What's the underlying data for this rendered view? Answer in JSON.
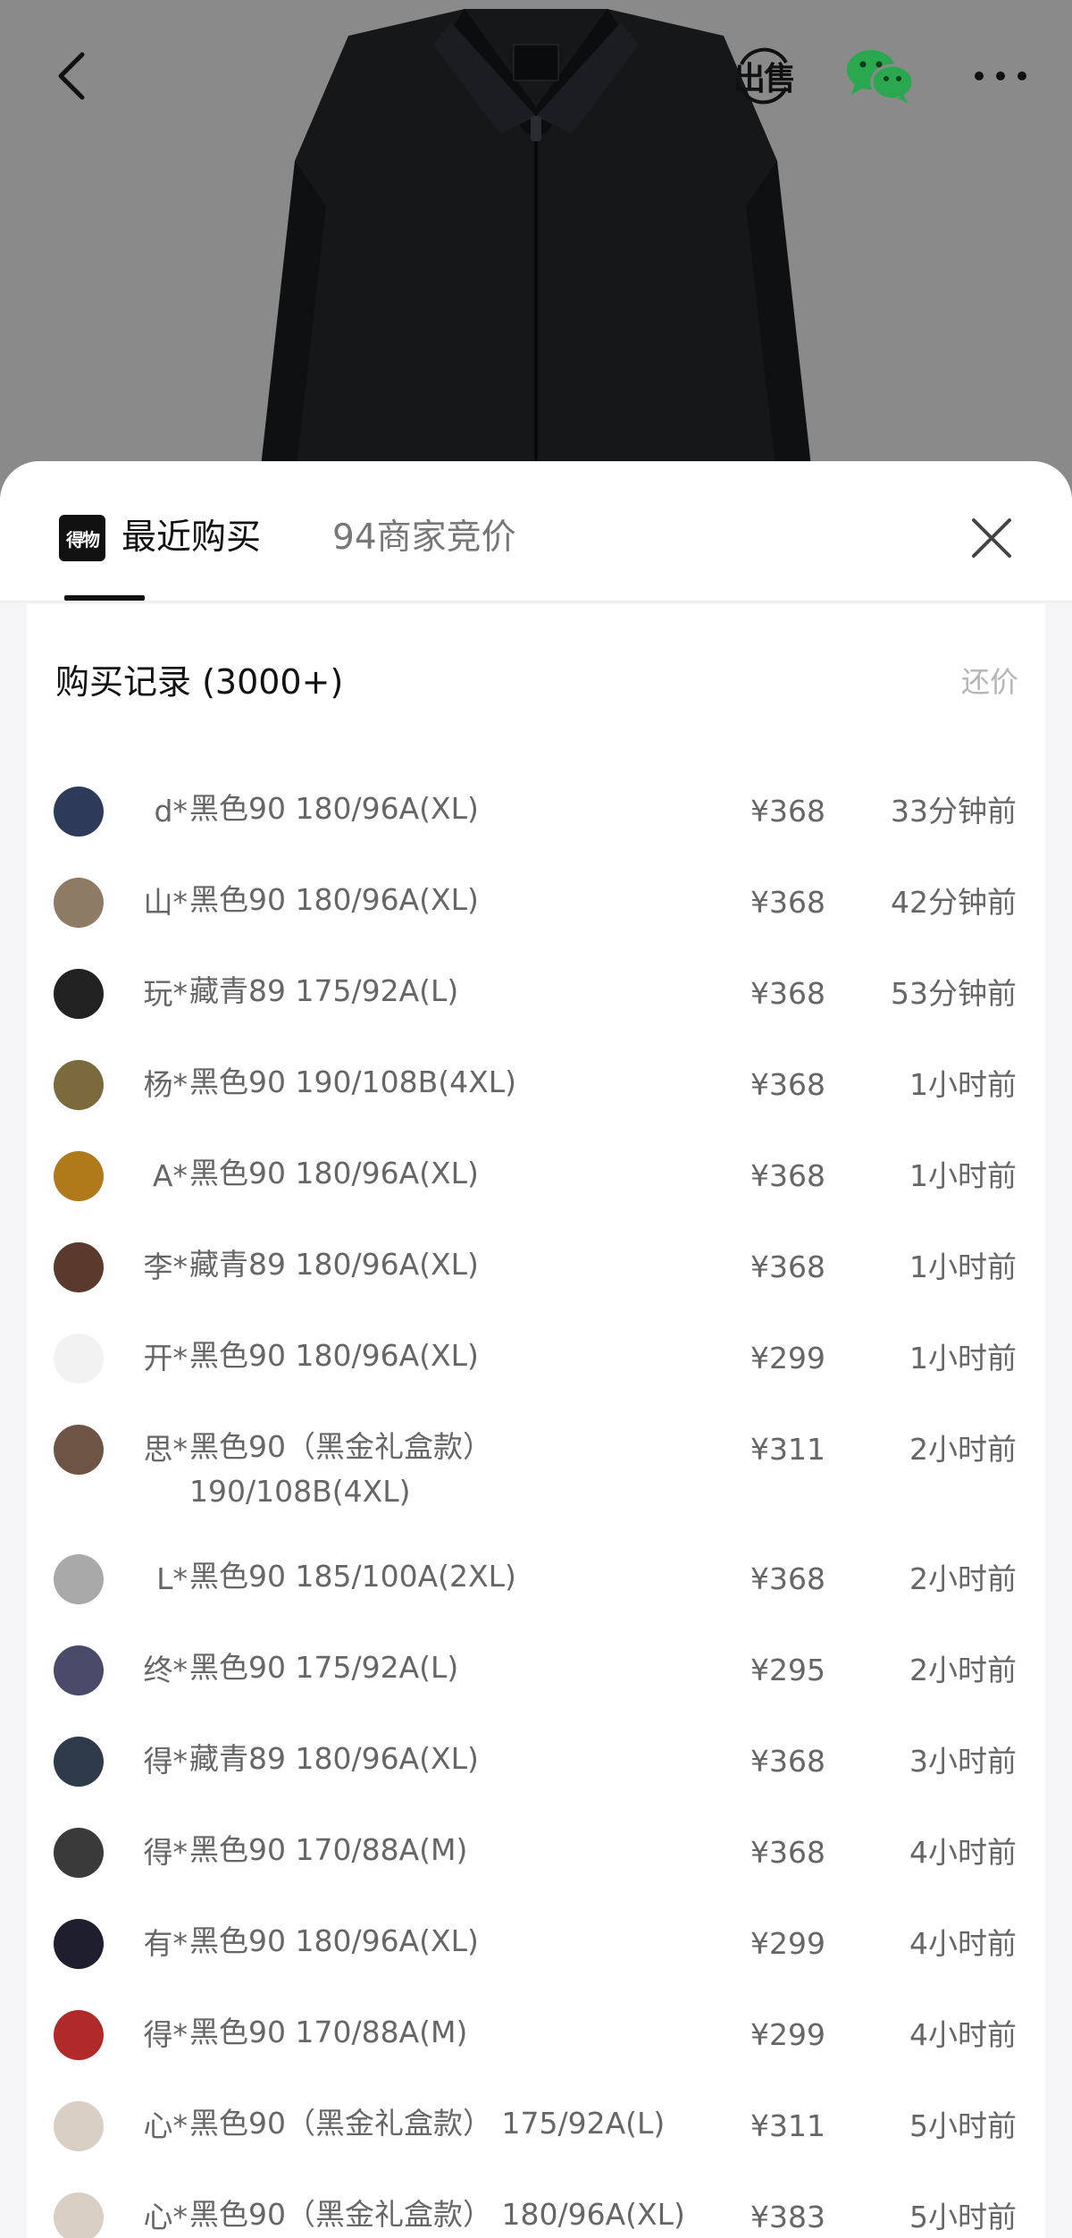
{
  "header": {
    "sell_label": "出售",
    "tabs": [
      {
        "logo": "得物",
        "label": "最近购买",
        "active": true
      },
      {
        "label": "94商家竞价",
        "active": false
      }
    ]
  },
  "icons": {
    "back": "chevron-left-icon",
    "sell": "sell-icon",
    "wechat": "wechat-icon",
    "more": "more-icon",
    "close": "close-icon"
  },
  "colors": {
    "wechat_green": "#2aa84f",
    "text_primary": "#111111",
    "text_secondary": "#666666"
  },
  "records": {
    "title": "购买记录 (3000+)",
    "action": "还价",
    "rows": [
      {
        "user": "d*",
        "spec": "黑色90 180/96A(XL)",
        "price": "¥368",
        "time": "33分钟前",
        "avatar_color": "#2d3a5a"
      },
      {
        "user": "山*",
        "spec": "黑色90 180/96A(XL)",
        "price": "¥368",
        "time": "42分钟前",
        "avatar_color": "#8e7b66"
      },
      {
        "user": "玩*",
        "spec": "藏青89 175/92A(L)",
        "price": "¥368",
        "time": "53分钟前",
        "avatar_color": "#222222"
      },
      {
        "user": "杨*",
        "spec": "黑色90 190/108B(4XL)",
        "price": "¥368",
        "time": "1小时前",
        "avatar_color": "#7a6a3e"
      },
      {
        "user": "A*",
        "spec": "黑色90 180/96A(XL)",
        "price": "¥368",
        "time": "1小时前",
        "avatar_color": "#b07a1a"
      },
      {
        "user": "李*",
        "spec": "藏青89 180/96A(XL)",
        "price": "¥368",
        "time": "1小时前",
        "avatar_color": "#5b3a2e"
      },
      {
        "user": "开*",
        "spec": "黑色90 180/96A(XL)",
        "price": "¥299",
        "time": "1小时前",
        "avatar_color": "#f2f2f2"
      },
      {
        "user": "思*",
        "spec": "黑色90（黑金礼盒款）\n190/108B(4XL)",
        "price": "¥311",
        "time": "2小时前",
        "avatar_color": "#6e5444"
      },
      {
        "user": "L*",
        "spec": "黑色90 185/100A(2XL)",
        "price": "¥368",
        "time": "2小时前",
        "avatar_color": "#a9a9a9"
      },
      {
        "user": "终*",
        "spec": "黑色90 175/92A(L)",
        "price": "¥295",
        "time": "2小时前",
        "avatar_color": "#4a4a6a"
      },
      {
        "user": "得*",
        "spec": "藏青89 180/96A(XL)",
        "price": "¥368",
        "time": "3小时前",
        "avatar_color": "#2f3a4a"
      },
      {
        "user": "得*",
        "spec": "黑色90 170/88A(M)",
        "price": "¥368",
        "time": "4小时前",
        "avatar_color": "#3a3a3a"
      },
      {
        "user": "有*",
        "spec": "黑色90 180/96A(XL)",
        "price": "¥299",
        "time": "4小时前",
        "avatar_color": "#1e1e2e"
      },
      {
        "user": "得*",
        "spec": "黑色90 170/88A(M)",
        "price": "¥299",
        "time": "4小时前",
        "avatar_color": "#b02a2a"
      },
      {
        "user": "心*",
        "spec": "黑色90（黑金礼盒款） 175/92A(L)",
        "price": "¥311",
        "time": "5小时前",
        "avatar_color": "#d9cfc4"
      },
      {
        "user": "心*",
        "spec": "黑色90（黑金礼盒款） 180/96A(XL)",
        "price": "¥383",
        "time": "5小时前",
        "avatar_color": "#d9cfc4"
      }
    ]
  }
}
